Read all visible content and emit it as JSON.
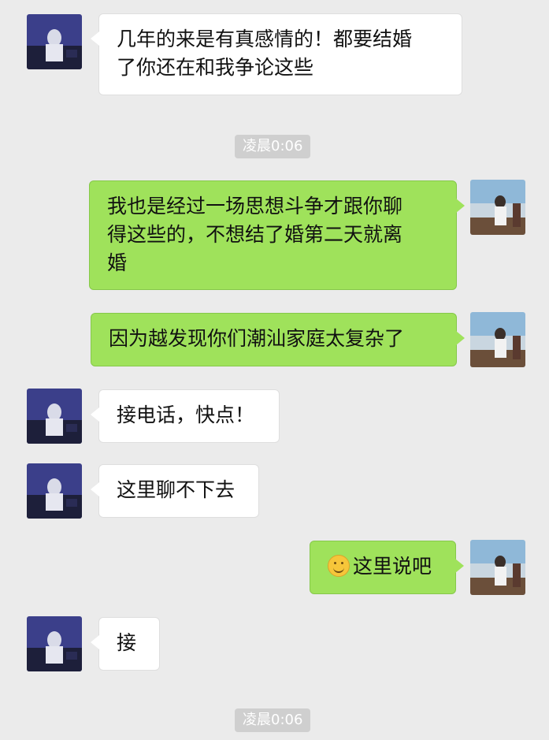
{
  "chat": {
    "messages": [
      {
        "side": "in",
        "lines": [
          "几年的来是有真感情的！都要结婚",
          "了你还在和我争论这些"
        ]
      },
      {
        "side": "out",
        "lines": [
          "我也是经过一场思想斗争才跟你聊",
          "得这些的，不想结了婚第二天就离",
          "婚"
        ]
      },
      {
        "side": "out",
        "lines": [
          "因为越发现你们潮汕家庭太复杂了"
        ]
      },
      {
        "side": "in",
        "lines": [
          "接电话，快点！"
        ]
      },
      {
        "side": "in",
        "lines": [
          "这里聊不下去"
        ]
      },
      {
        "side": "out",
        "emoji": "smile-emoji",
        "lines": [
          "这里说吧"
        ]
      },
      {
        "side": "in",
        "lines": [
          "接"
        ]
      }
    ],
    "timestamps": [
      "凌晨0:06",
      "凌晨0:06"
    ]
  },
  "colors": {
    "background": "#ebebeb",
    "incoming_bubble": "#ffffff",
    "outgoing_bubble": "#9fe25b",
    "timestamp_pill": "#cfcfcf"
  }
}
